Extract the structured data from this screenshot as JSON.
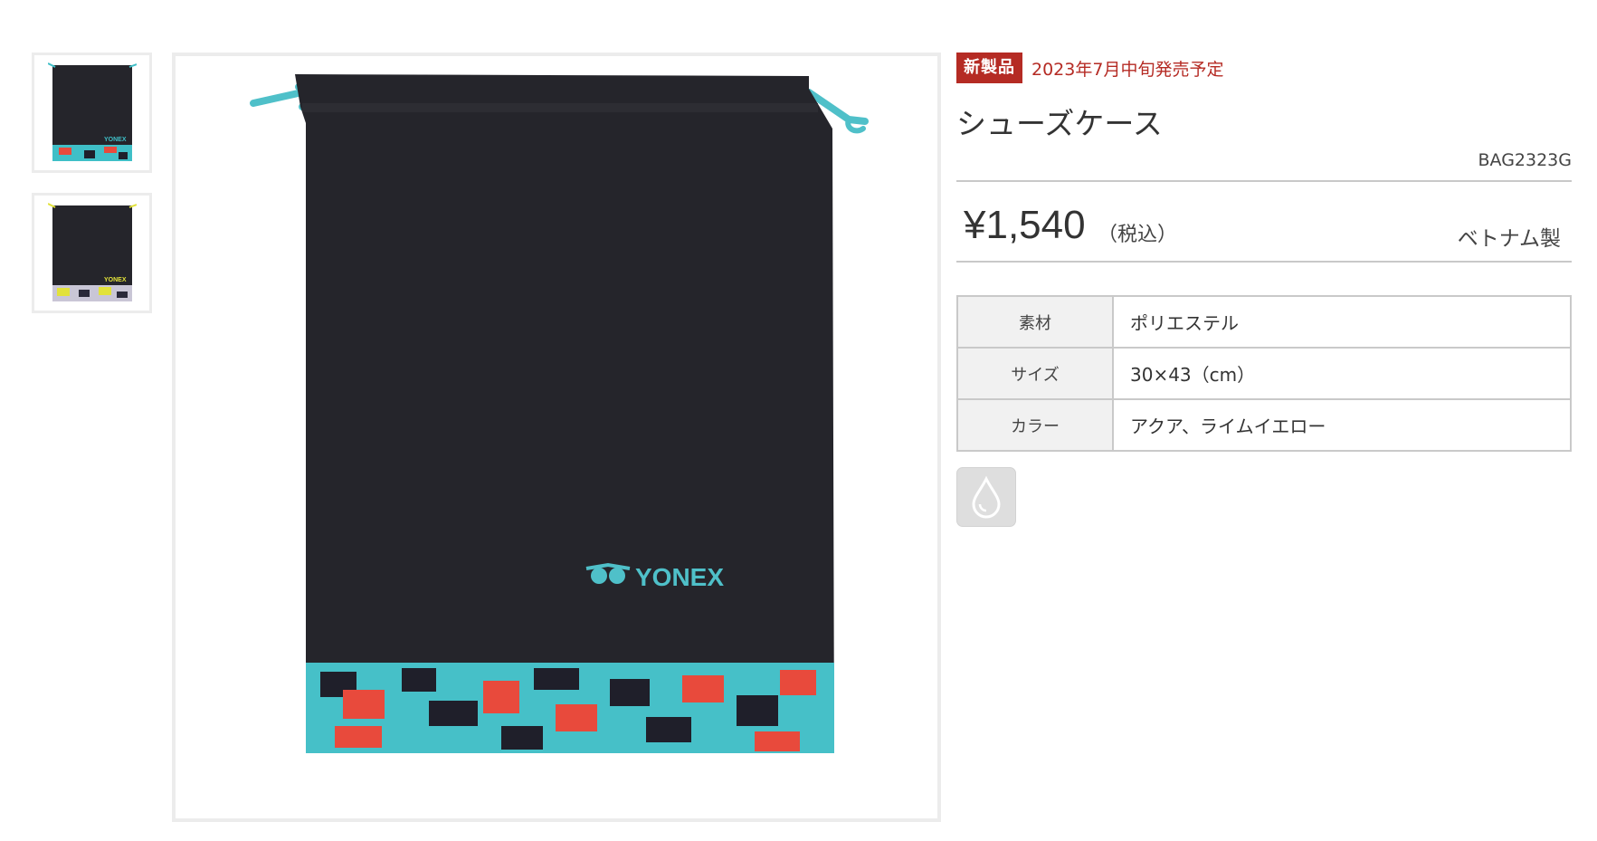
{
  "gallery": {
    "thumbnails": [
      {
        "color": "アクア",
        "accent": "#3fbfc7"
      },
      {
        "color": "ライムイエロー",
        "accent": "#e2e23a"
      }
    ],
    "main_image": {
      "accent": "#4fc0c9",
      "body_color": "#25252b",
      "logo_text": "YONEX"
    }
  },
  "product": {
    "new_badge": "新製品",
    "release_note": "2023年7月中旬発売予定",
    "name": "シューズケース",
    "code": "BAG2323G",
    "price": "¥1,540",
    "tax_note": "（税込）",
    "origin": "ベトナム製",
    "specs": [
      {
        "label": "素材",
        "value": "ポリエステル"
      },
      {
        "label": "サイズ",
        "value": "30×43（cm）"
      },
      {
        "label": "カラー",
        "value": "アクア、ライムイエロー"
      }
    ],
    "feature_icon": "water-drop-icon"
  },
  "colors": {
    "brand_red": "#b52b24",
    "border": "#c9c9c9",
    "label_bg": "#f1f1f1"
  }
}
